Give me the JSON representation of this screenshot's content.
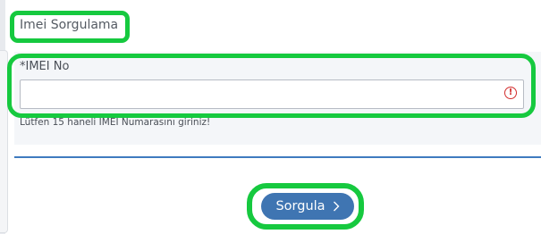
{
  "page": {
    "title": "Imei Sorgulama"
  },
  "form": {
    "imei_label": "*IMEI No",
    "imei_value": "",
    "imei_placeholder": "",
    "helper_text": "Lütfen 15 haneli IMEI Numarasını giriniz!",
    "error_icon": "!"
  },
  "actions": {
    "submit_label": "Sorgula",
    "submit_icon": "chevron-right-icon"
  },
  "colors": {
    "highlight": "#16c93f",
    "button": "#3f75b2",
    "divider": "#3f7bbf",
    "error": "#d22d2d"
  }
}
